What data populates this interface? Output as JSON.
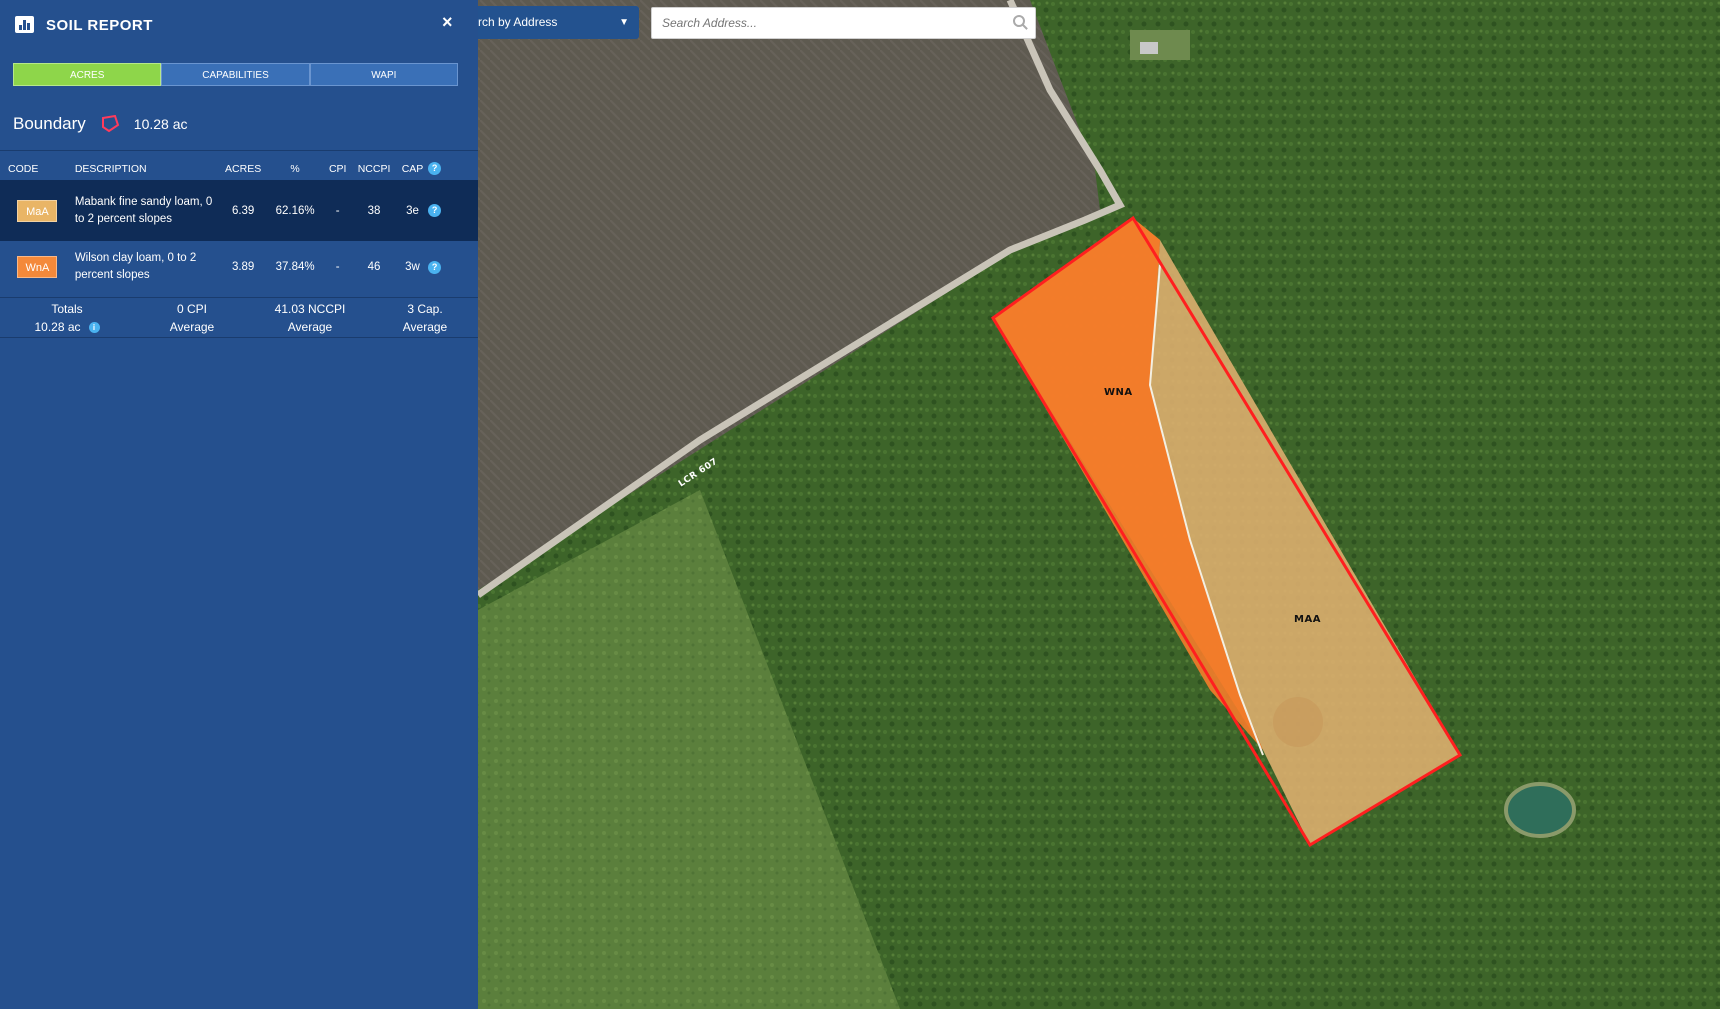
{
  "panel": {
    "title": "SOIL REPORT",
    "close_label": "×",
    "tabs": [
      {
        "label": "ACRES",
        "active": true
      },
      {
        "label": "CAPABILITIES",
        "active": false
      },
      {
        "label": "WAPI",
        "active": false
      }
    ],
    "boundary": {
      "label": "Boundary",
      "area": "10.28 ac"
    },
    "table": {
      "headers": [
        "CODE",
        "DESCRIPTION",
        "ACRES",
        "%",
        "CPI",
        "NCCPI",
        "CAP"
      ],
      "rows": [
        {
          "code": "MaA",
          "color": "#e9b566",
          "description": "Mabank fine sandy loam, 0 to 2 percent slopes",
          "acres": "6.39",
          "percent": "62.16%",
          "cpi": "-",
          "nccpi": "38",
          "cap": "3e"
        },
        {
          "code": "WnA",
          "color": "#f4893a",
          "description": "Wilson clay loam, 0 to 2 percent slopes",
          "acres": "3.89",
          "percent": "37.84%",
          "cpi": "-",
          "nccpi": "46",
          "cap": "3w"
        }
      ]
    },
    "totals": {
      "label": "Totals",
      "acres": "10.28 ac",
      "cpi_value": "0 CPI",
      "cpi_sub": "Average",
      "nccpi_value": "41.03 NCCPI",
      "nccpi_sub": "Average",
      "cap_value": "3 Cap.",
      "cap_sub": "Average"
    }
  },
  "search": {
    "by_label": "rch by Address",
    "placeholder": "Search Address..."
  },
  "map": {
    "labels": {
      "wna": "WNA",
      "maa": "MAA",
      "road": "LCR 607"
    },
    "colors": {
      "wna": "#f47c2a",
      "maa": "#e0b070",
      "boundary": "#ff2020"
    }
  }
}
